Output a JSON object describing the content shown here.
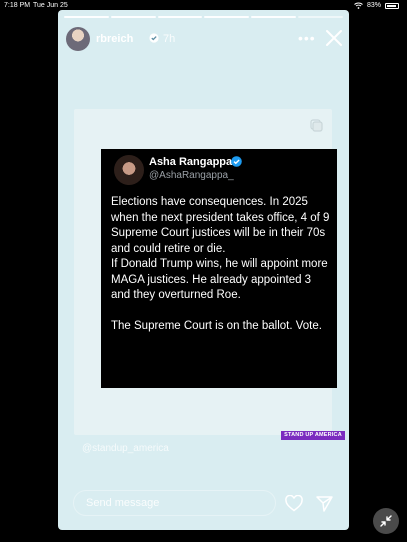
{
  "status_bar": {
    "time": "7:18 PM",
    "date": "Tue Jun 25",
    "battery": "83%"
  },
  "story": {
    "progress_segments": 6,
    "progress_current": 5,
    "header": {
      "username": "rbreich",
      "time_ago": "7h"
    },
    "tweet": {
      "name": "Asha Rangappa",
      "handle": "@AshaRangappa_",
      "body": "Elections have consequences. In 2025 when the next president takes office, 4 of 9 Supreme Court justices will be in their 70s and could retire or die.\nIf Donald Trump wins, he will appoint more MAGA justices. He already appointed 3 and they overturned Roe.\n\nThe Supreme Court is on the ballot. Vote."
    },
    "brand_label": "STAND UP AMERICA",
    "mention": "@standup_america",
    "message_placeholder": "Send message"
  },
  "colors": {
    "story_bg": "#d9edf1",
    "card_bg": "#e6f2f4",
    "badge": "#7b2cbf",
    "verified": "#1d9bf0"
  },
  "icons": {
    "more": "more-horizontal-icon",
    "close": "close-icon",
    "verified": "verified-badge-icon",
    "copy": "copy-icon",
    "heart": "heart-icon",
    "send": "send-icon",
    "collapse": "collapse-arrows-icon"
  }
}
